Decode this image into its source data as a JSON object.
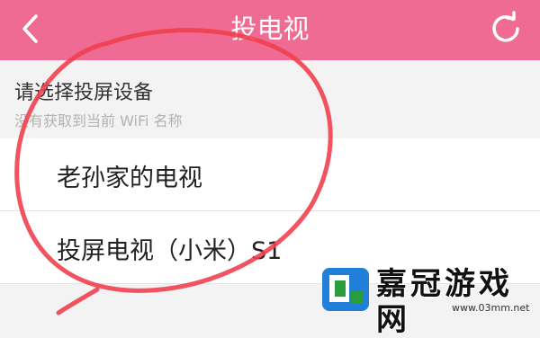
{
  "header": {
    "title": "投电视",
    "back_icon": "chevron-left-icon",
    "refresh_icon": "refresh-icon",
    "bg_color": "#f06b93"
  },
  "section": {
    "title": "请选择投屏设备",
    "subtitle": "没有获取到当前 WiFi 名称"
  },
  "devices": [
    {
      "label": "老孙家的电视"
    },
    {
      "label": "投屏电视（小米）S1"
    }
  ],
  "watermark": {
    "name": "嘉冠游戏网",
    "url": "www.03mm.net"
  },
  "annotation": {
    "color": "#f04050"
  }
}
